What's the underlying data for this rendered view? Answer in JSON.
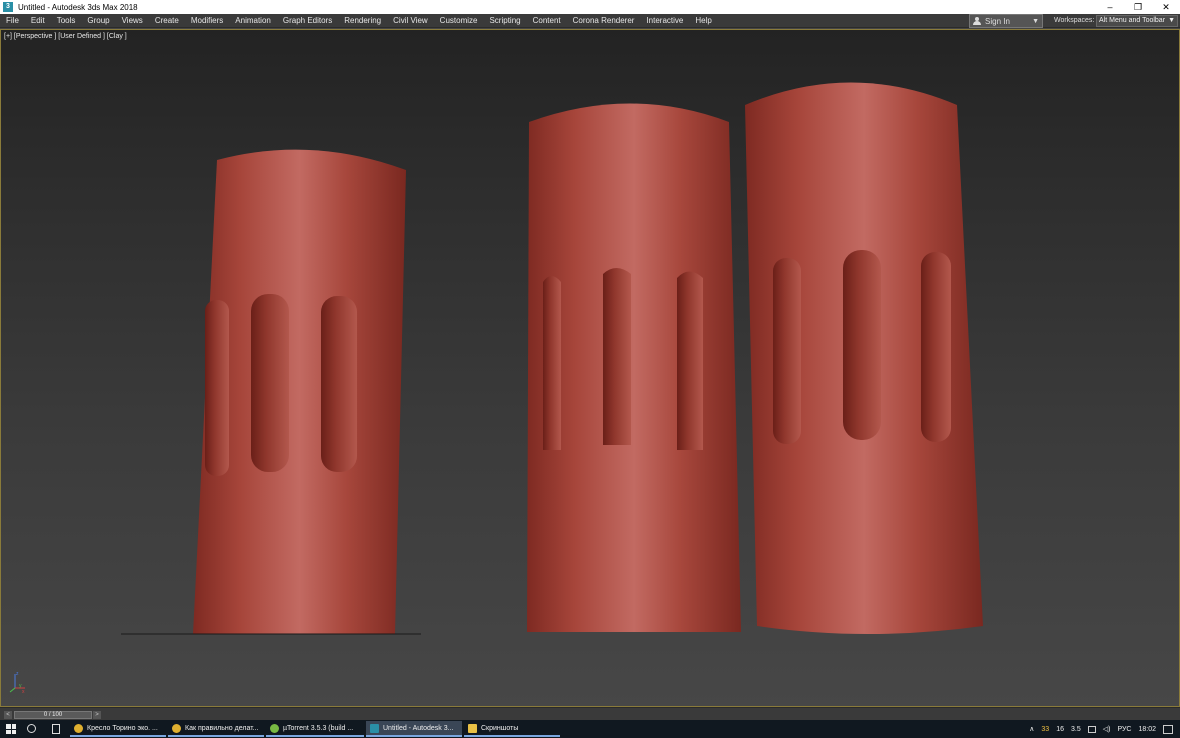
{
  "window": {
    "title": "Untitled - Autodesk 3ds Max 2018",
    "app_icon_text": "3",
    "controls": [
      "–",
      "❐",
      "✕"
    ]
  },
  "menu": {
    "items": [
      "File",
      "Edit",
      "Tools",
      "Group",
      "Views",
      "Create",
      "Modifiers",
      "Animation",
      "Graph Editors",
      "Rendering",
      "Civil View",
      "Customize",
      "Scripting",
      "Content",
      "Corona Renderer",
      "Interactive",
      "Help"
    ],
    "signin_label": "Sign In",
    "workspaces_label": "Workspaces:",
    "workspace_value": "Alt Menu and Toolbar"
  },
  "viewport": {
    "label": "[+] [Perspective ] [User Defined ] [Clay ]",
    "model_color": "#a6453a",
    "axis_labels": [
      "z",
      "y",
      "x"
    ]
  },
  "timeslider": {
    "frame": "0 / 100",
    "prev": "<",
    "next": ">"
  },
  "taskbar": {
    "tasks": [
      {
        "label": "Кресло Торино эко. ...",
        "icon": "chrome-icon",
        "color": "#e0b030"
      },
      {
        "label": "Как правильно делат...",
        "icon": "chrome-icon",
        "color": "#e0b030"
      },
      {
        "label": "µTorrent 3.5.3 (build ...",
        "icon": "utorrent-icon",
        "color": "#78b943"
      },
      {
        "label": "Untitled - Autodesk 3...",
        "icon": "3dsmax-icon",
        "color": "#2a8fa6"
      },
      {
        "label": "Скриншоты",
        "icon": "folder-icon",
        "color": "#e8c045"
      }
    ],
    "tray": {
      "num1": "33",
      "num2": "16",
      "num3": "3.5",
      "lang": "РУС",
      "time": "18:02"
    }
  }
}
